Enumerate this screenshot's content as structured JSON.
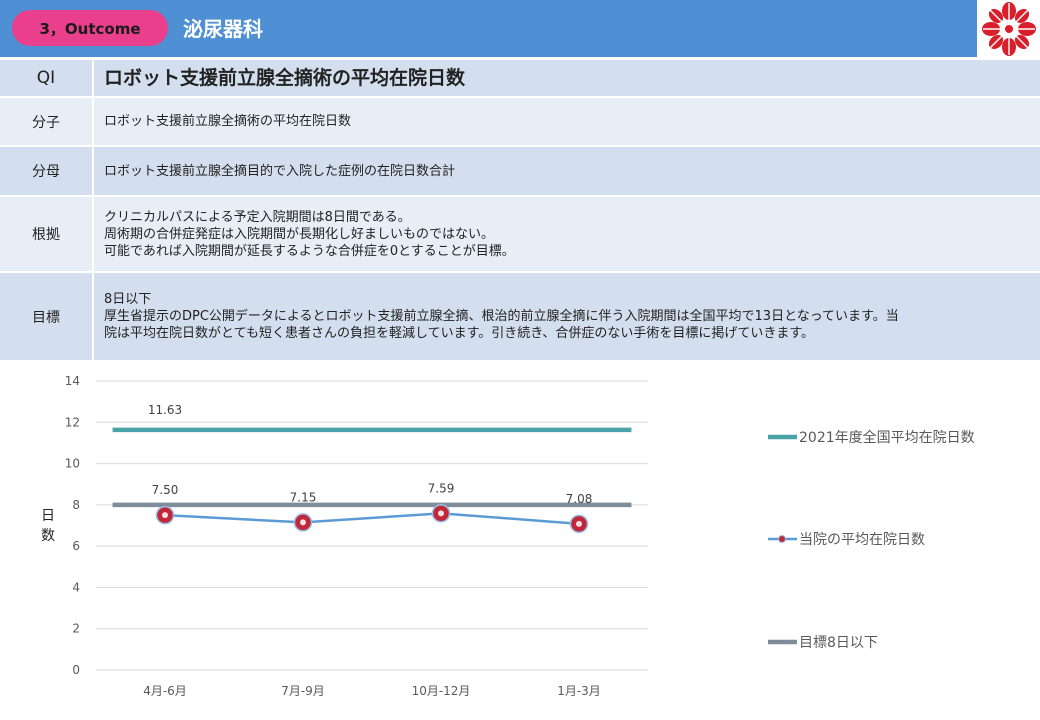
{
  "header": {
    "badge": "3，Outcome",
    "department": "泌尿器科"
  },
  "table": {
    "title_label": "QI",
    "title_text": "ロボット支援前立腺全摘術の平均在院日数",
    "rows": [
      {
        "label": "分子",
        "lines": [
          "ロボット支援前立腺全摘術の平均在院日数"
        ]
      },
      {
        "label": "分母",
        "lines": [
          "ロボット支援前立腺全摘目的で入院した症例の在院日数合計"
        ]
      },
      {
        "label": "根拠",
        "lines": [
          "クリニカルパスによる予定入院期間は8日間である。",
          "周術期の合併症発症は入院期間が長期化し好ましいものではない。",
          "可能であれば入院期間が延長するような合併症を0とすることが目標。"
        ]
      },
      {
        "label": "目標",
        "lines": [
          "8日以下",
          "厚生省提示のDPC公開データによるとロボット支援前立腺全摘、根治的前立腺全摘に伴う入院期間は全国平均で13日となっています。当",
          "院は平均在院日数がとても短く患者さんの負担を軽減しています。引き続き、合併症のない手術を目標に掲げていきます。"
        ]
      }
    ]
  },
  "chart_data": {
    "type": "line",
    "categories": [
      "4月-6月",
      "7月-9月",
      "10月-12月",
      "1月-3月"
    ],
    "ylabel": "日数",
    "ylim": [
      0,
      14
    ],
    "yticks": [
      0,
      2,
      4,
      6,
      8,
      10,
      12,
      14
    ],
    "grid": true,
    "legend_position": "right",
    "series": [
      {
        "name": "2021年度全国平均在院日数",
        "values": [
          11.63,
          11.63,
          11.63,
          11.63
        ],
        "labels": [
          "11.63",
          "",
          "",
          ""
        ],
        "color": "#4aa3a8"
      },
      {
        "name": "当院の平均在院日数",
        "values": [
          7.5,
          7.15,
          7.59,
          7.08
        ],
        "labels": [
          "7.50",
          "7.15",
          "7.59",
          "7.08"
        ],
        "color": "#5b9bd5",
        "marker_color": "#c0283a"
      },
      {
        "name": "目標8日以下",
        "values": [
          8,
          8,
          8,
          8
        ],
        "labels": [
          "",
          "",
          "",
          ""
        ],
        "color": "#7f8c9a"
      }
    ]
  }
}
